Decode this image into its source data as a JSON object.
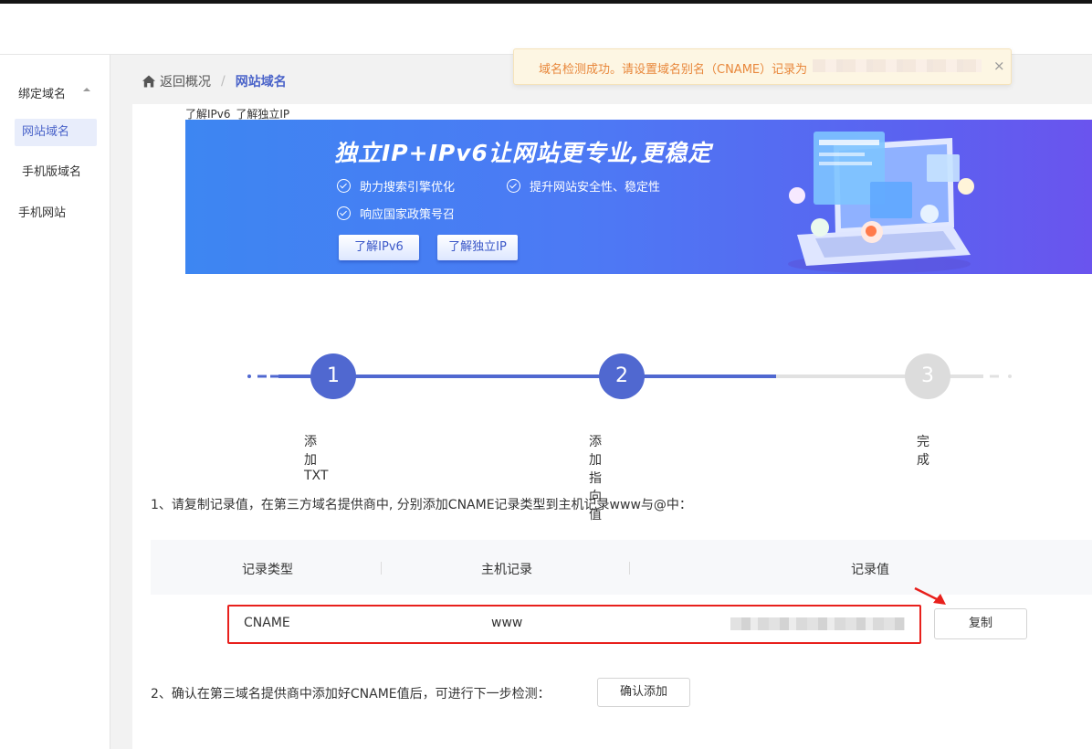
{
  "sidebar": {
    "group_label": "绑定域名",
    "items": [
      {
        "label": "网站域名",
        "active": true
      },
      {
        "label": "手机版域名",
        "active": false
      },
      {
        "label": "手机网站",
        "active": false
      }
    ]
  },
  "breadcrumb": {
    "back_label": "返回概况",
    "separator": "/",
    "current": "网站域名"
  },
  "toast": {
    "message": "域名检测成功。请设置域名别名（CNAME）记录为",
    "close_symbol": "×"
  },
  "promo_links": {
    "ipv6": "了解IPv6",
    "dedicated_ip": "了解独立IP"
  },
  "banner": {
    "title": "独立IP+IPv6让网站更专业,更稳定",
    "features": [
      "助力搜索引擎优化",
      "提升网站安全性、稳定性",
      "响应国家政策号召"
    ],
    "btn_ipv6": "了解IPv6",
    "btn_ip": "了解独立IP"
  },
  "steps": [
    {
      "number": "1",
      "label": "添加TXT",
      "status": "done"
    },
    {
      "number": "2",
      "label": "添加指向值",
      "status": "current"
    },
    {
      "number": "3",
      "label": "完成",
      "status": "todo"
    }
  ],
  "instruction": "1、请复制记录值，在第三方域名提供商中, 分别添加CNAME记录类型到主机记录www与@中：",
  "table": {
    "headers": [
      "记录类型",
      "主机记录",
      "记录值"
    ],
    "row": {
      "type": "CNAME",
      "host": "www"
    }
  },
  "copy_button": "复制",
  "confirm": {
    "text": "2、确认在第三域名提供商中添加好CNAME值后，可进行下一步检测：",
    "button": "确认添加"
  },
  "colors": {
    "accent": "#5068d0",
    "toast_text": "#e8873b",
    "highlight": "#e8201c"
  }
}
